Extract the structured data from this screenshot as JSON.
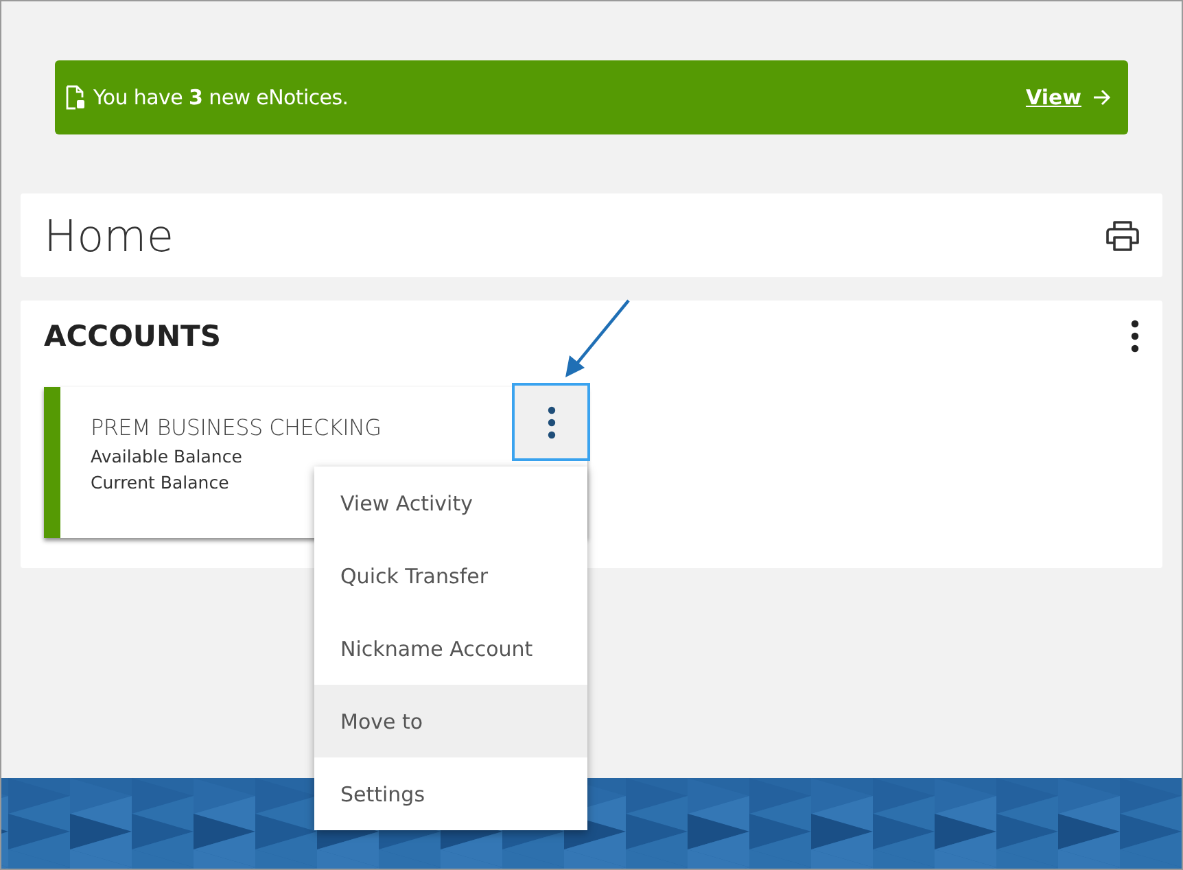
{
  "notice": {
    "text": "You have **3** new eNotices.",
    "link": "View"
  },
  "home": {
    "title": "Home"
  },
  "accounts": {
    "title": "ACCOUNTS",
    "items": [
      {
        "name": "PREM BUSINESS CHECKING",
        "lines": [
          "Available Balance",
          "Current Balance"
        ],
        "menu_focused": true
      }
    ]
  },
  "menu": {
    "items": [
      {
        "label": "View Activity",
        "selected": false
      },
      {
        "label": "Quick Transfer",
        "selected": false
      },
      {
        "label": "Nickname Account",
        "selected": false
      },
      {
        "label": "Move to",
        "selected": true
      },
      {
        "label": "Settings",
        "selected": false
      }
    ]
  }
}
